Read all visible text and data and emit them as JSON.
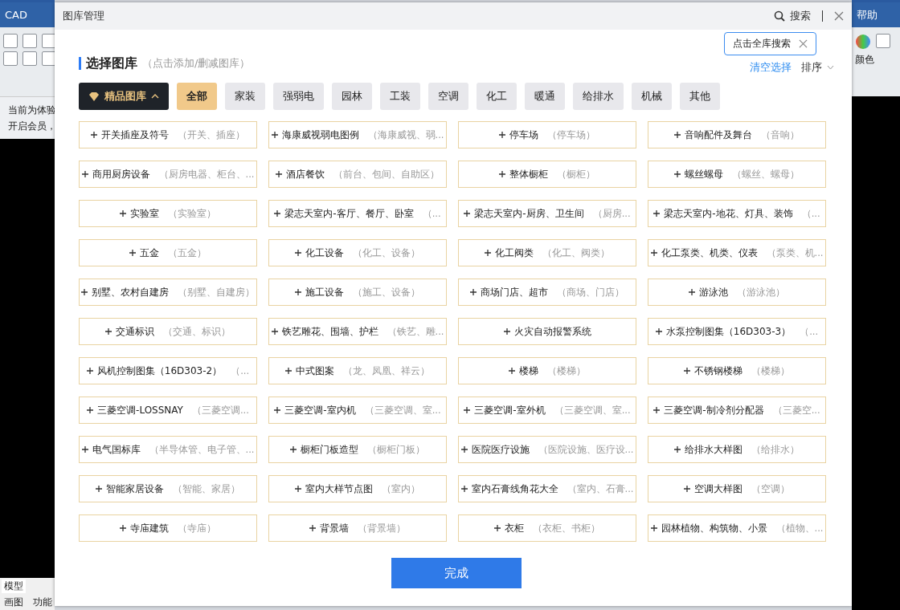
{
  "background_app": {
    "title": "CAD",
    "help": "帮助",
    "color_label": "颜色",
    "notice_lines": [
      "当前为体验",
      "开启会员，"
    ],
    "sheet_tab": "模型",
    "bottom_tabs": [
      "画图",
      "功能"
    ]
  },
  "dialog": {
    "title": "图库管理",
    "search_label": "搜索",
    "tooltip": "点击全库搜索"
  },
  "header": {
    "title": "选择图库",
    "hint": "（点击添加/删减图库）",
    "clear": "清空选择",
    "sort": "排序"
  },
  "premium": {
    "label": "精品图库",
    "expanded": true
  },
  "categories": [
    {
      "label": "全部",
      "selected": true
    },
    {
      "label": "家装",
      "selected": false
    },
    {
      "label": "强弱电",
      "selected": false
    },
    {
      "label": "园林",
      "selected": false
    },
    {
      "label": "工装",
      "selected": false
    },
    {
      "label": "空调",
      "selected": false
    },
    {
      "label": "化工",
      "selected": false
    },
    {
      "label": "暖通",
      "selected": false
    },
    {
      "label": "给排水",
      "selected": false
    },
    {
      "label": "机械",
      "selected": false
    },
    {
      "label": "其他",
      "selected": false
    }
  ],
  "libraries": [
    {
      "name": "开关插座及符号",
      "tags": "（开关、插座）"
    },
    {
      "name": "海康威视弱电图例",
      "tags": "（海康威视、弱..."
    },
    {
      "name": "停车场",
      "tags": "（停车场）"
    },
    {
      "name": "音响配件及舞台",
      "tags": "（音响）"
    },
    {
      "name": "商用厨房设备",
      "tags": "（厨房电器、柜台、..."
    },
    {
      "name": "酒店餐饮",
      "tags": "（前台、包间、自助区）"
    },
    {
      "name": "整体橱柜",
      "tags": "（橱柜）"
    },
    {
      "name": "螺丝螺母",
      "tags": "（螺丝、螺母）"
    },
    {
      "name": "实验室",
      "tags": "（实验室）"
    },
    {
      "name": "梁志天室内-客厅、餐厅、卧室",
      "tags": "（..."
    },
    {
      "name": "梁志天室内-厨房、卫生间",
      "tags": "（厨房..."
    },
    {
      "name": "梁志天室内-地花、灯具、装饰",
      "tags": "（..."
    },
    {
      "name": "五金",
      "tags": "（五金）"
    },
    {
      "name": "化工设备",
      "tags": "（化工、设备）"
    },
    {
      "name": "化工阀类",
      "tags": "（化工、阀类）"
    },
    {
      "name": "化工泵类、机类、仪表",
      "tags": "（泵类、机..."
    },
    {
      "name": "别墅、农村自建房",
      "tags": "（别墅、自建房）"
    },
    {
      "name": "施工设备",
      "tags": "（施工、设备）"
    },
    {
      "name": "商场门店、超市",
      "tags": "（商场、门店）"
    },
    {
      "name": "游泳池",
      "tags": "（游泳池）"
    },
    {
      "name": "交通标识",
      "tags": "（交通、标识）"
    },
    {
      "name": "铁艺雕花、围墙、护栏",
      "tags": "（铁艺、雕..."
    },
    {
      "name": "火灾自动报警系统"
    },
    {
      "name": "水泵控制图集（16D303-3）",
      "tags": "（..."
    },
    {
      "name": "风机控制图集（16D303-2）",
      "tags": "（..."
    },
    {
      "name": "中式图案",
      "tags": "（龙、凤凰、祥云）"
    },
    {
      "name": "楼梯",
      "tags": "（楼梯）"
    },
    {
      "name": "不锈钢楼梯",
      "tags": "（楼梯）"
    },
    {
      "name": "三菱空调-LOSSNAY",
      "tags": "（三菱空调..."
    },
    {
      "name": "三菱空调-室内机",
      "tags": "（三菱空调、室..."
    },
    {
      "name": "三菱空调-室外机",
      "tags": "（三菱空调、室..."
    },
    {
      "name": "三菱空调-制冷剂分配器",
      "tags": "（三菱空..."
    },
    {
      "name": "电气国标库",
      "tags": "（半导体管、电子管、..."
    },
    {
      "name": "橱柜门板造型",
      "tags": "（橱柜门板）"
    },
    {
      "name": "医院医疗设施",
      "tags": "（医院设施、医疗设..."
    },
    {
      "name": "给排水大样图",
      "tags": "（给排水）"
    },
    {
      "name": "智能家居设备",
      "tags": "（智能、家居）"
    },
    {
      "name": "室内大样节点图",
      "tags": "（室内）"
    },
    {
      "name": "室内石膏线角花大全",
      "tags": "（室内、石膏..."
    },
    {
      "name": "空调大样图",
      "tags": "（空调）"
    },
    {
      "name": "寺庙建筑",
      "tags": "（寺庙）"
    },
    {
      "name": "背景墙",
      "tags": "（背景墙）"
    },
    {
      "name": "衣柜",
      "tags": "（衣柜、书柜）"
    },
    {
      "name": "园林植物、构筑物、小景",
      "tags": "（植物、..."
    }
  ],
  "done_button": "完成"
}
